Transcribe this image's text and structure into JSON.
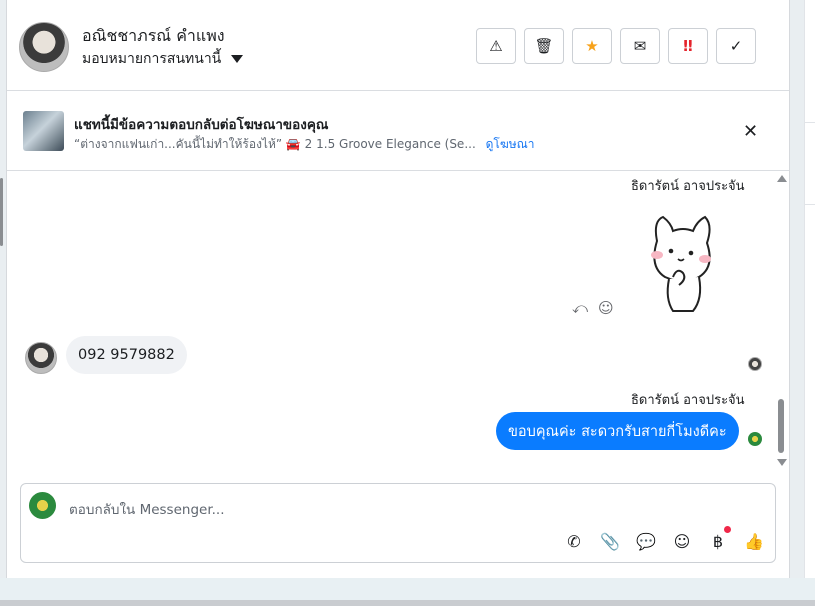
{
  "header": {
    "contact_name": "อณิชชาภรณ์ คำแพง",
    "assign_label": "มอบหมายการสนทนานี้",
    "actions": [
      {
        "name": "report-button",
        "glyph": "⚠"
      },
      {
        "name": "delete-button",
        "glyph": "🗑"
      },
      {
        "name": "star-button",
        "glyph": "★"
      },
      {
        "name": "mark-unread-button",
        "glyph": "✉"
      },
      {
        "name": "important-button",
        "glyph": "‼"
      },
      {
        "name": "done-button",
        "glyph": "✓"
      }
    ]
  },
  "ad_banner": {
    "title": "แชทนี้มีข้อความตอบกลับต่อโฆษณาของคุณ",
    "subtitle": "“ต่างจากแฟนเก่า...คันนี้ไม่ทำให้ร้องไห้” 🚘 2 1.5 Groove Elegance (Se...",
    "link_label": "ดูโฆษณา",
    "close_glyph": "✕"
  },
  "chat": {
    "sender_outgoing_1": "ธิดารัตน์ อาจประจัน",
    "incoming_message": "092 9579882",
    "sender_outgoing_2": "ธิดารัตน์ อาจประจัน",
    "outgoing_message": "ขอบคุณค่ะ สะดวกรับสายกี่โมงดีคะ",
    "message_icons": {
      "reply": "⤺",
      "react": "☺"
    }
  },
  "composer": {
    "placeholder": "ตอบกลับใน Messenger...",
    "tools": [
      {
        "name": "call-icon",
        "glyph": "✆"
      },
      {
        "name": "attach-icon",
        "glyph": "📎"
      },
      {
        "name": "saved-replies-icon",
        "glyph": "💬"
      },
      {
        "name": "emoji-icon",
        "glyph": "☺"
      },
      {
        "name": "payment-icon",
        "glyph": "฿"
      },
      {
        "name": "like-icon",
        "glyph": "👍"
      }
    ]
  },
  "colors": {
    "accent": "#0a7cff",
    "link": "#1877f2",
    "star": "#f7a21b",
    "important": "#e4232b"
  }
}
